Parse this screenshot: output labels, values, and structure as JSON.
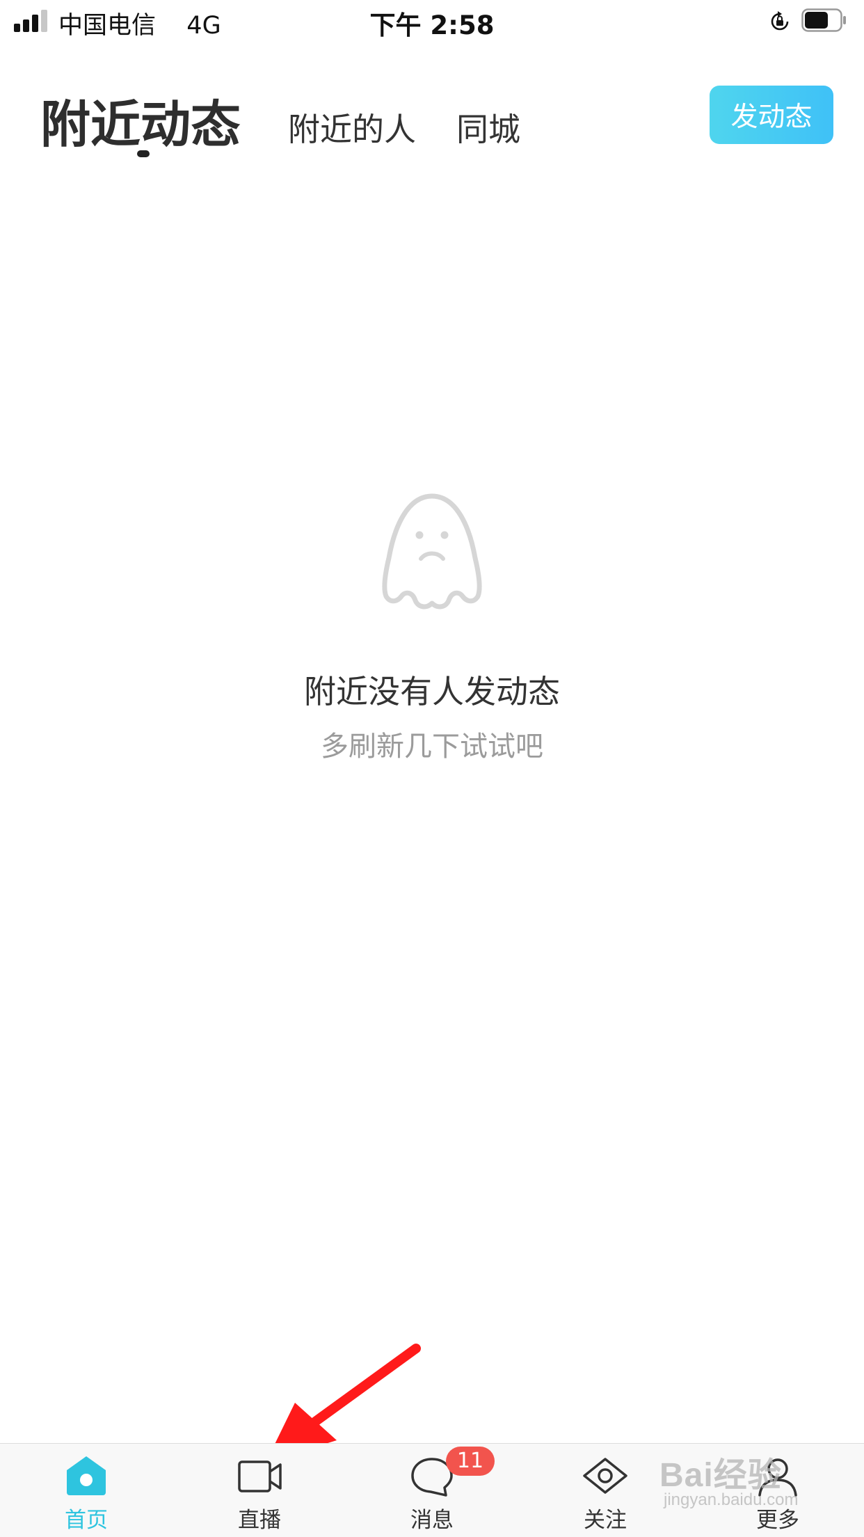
{
  "status_bar": {
    "carrier": "中国电信",
    "network": "4G",
    "time": "下午 2:58",
    "signal_bars_filled": 3,
    "signal_bars_total": 4,
    "battery_level": 0.65
  },
  "header": {
    "tabs": [
      {
        "label": "附近动态",
        "active": true
      },
      {
        "label": "附近的人",
        "active": false
      },
      {
        "label": "同城",
        "active": false
      }
    ],
    "post_button_label": "发动态"
  },
  "empty_state": {
    "icon": "sad-ghost-icon",
    "title": "附近没有人发动态",
    "subtitle": "多刷新几下试试吧"
  },
  "tabbar": {
    "items": [
      {
        "label": "首页",
        "icon": "home-icon",
        "active": true
      },
      {
        "label": "直播",
        "icon": "video-camera-icon",
        "active": false
      },
      {
        "label": "消息",
        "icon": "chat-bubble-icon",
        "active": false,
        "badge": "11"
      },
      {
        "label": "关注",
        "icon": "eye-icon",
        "active": false
      },
      {
        "label": "更多",
        "icon": "person-icon",
        "active": false
      }
    ]
  },
  "watermark": {
    "main": "Bai经验",
    "sub": "jingyan.baidu.com"
  },
  "colors": {
    "accent": "#2ec4df",
    "post_button_gradient_start": "#4fd5ee",
    "post_button_gradient_end": "#3fc1f7",
    "badge": "#f2544d",
    "annotation_arrow": "#ff1a1a"
  }
}
